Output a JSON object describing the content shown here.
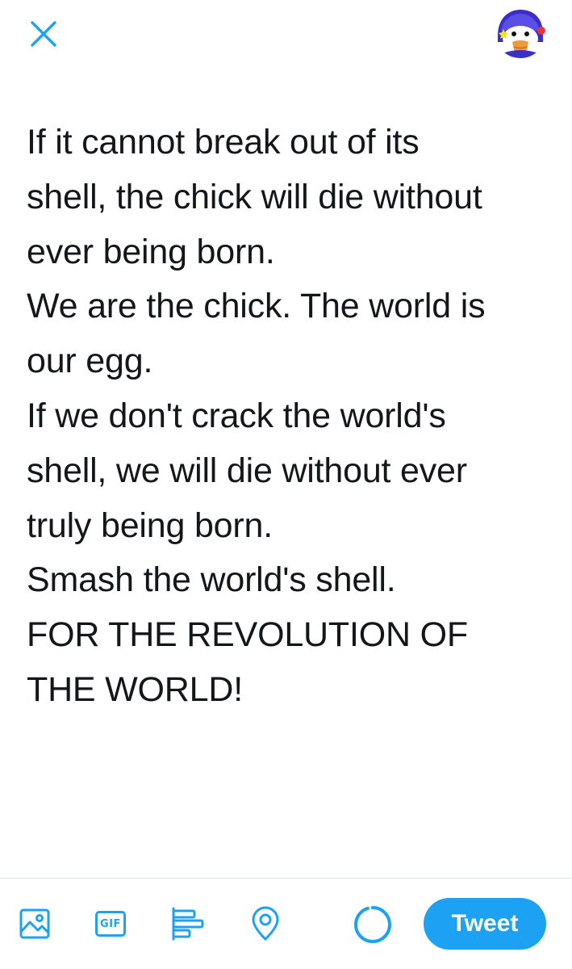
{
  "header": {
    "close_icon": "close-icon",
    "avatar_icon": "penguin-avatar-icon"
  },
  "compose": {
    "lines": [
      "If it cannot break out of its",
      "shell, the chick will die without",
      "ever being born.",
      "We are the chick. The world is",
      "our egg.",
      "If we don't crack the world's",
      "shell, we will die without ever",
      "truly being born.",
      "Smash the world's shell.",
      "FOR THE REVOLUTION OF",
      "THE WORLD!"
    ]
  },
  "toolbar": {
    "image_icon": "image-icon",
    "gif_label": "GIF",
    "poll_icon": "poll-icon",
    "location_icon": "location-icon",
    "character_count_progress": 0.95,
    "tweet_label": "Tweet"
  },
  "colors": {
    "accent": "#1da1f2",
    "text": "#14171a",
    "divider": "#e1e8ed",
    "ring_track": "#e1e8ed"
  }
}
